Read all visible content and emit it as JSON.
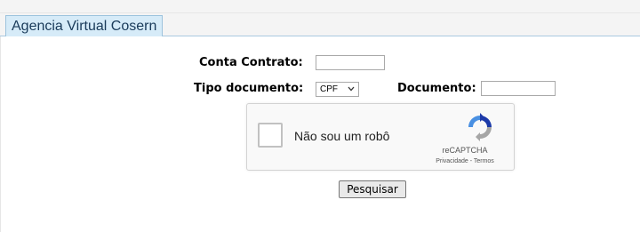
{
  "app": {
    "tab_label": "Agencia Virtual Cosern"
  },
  "form": {
    "conta_contrato_label": "Conta Contrato:",
    "conta_contrato_value": "",
    "tipo_documento_label": "Tipo documento:",
    "tipo_documento_selected": "CPF",
    "documento_label": "Documento:",
    "documento_value": ""
  },
  "captcha": {
    "checkbox_text": "Não sou um robô",
    "brand": "reCAPTCHA",
    "links": "Privacidade - Termos",
    "checked": false
  },
  "actions": {
    "search_label": "Pesquisar"
  },
  "colors": {
    "tab_bg": "#d6ebf8",
    "tab_border": "#9cc3dd",
    "captcha_blue": "#1c3aa9",
    "captcha_lightblue": "#4a90e2",
    "captcha_gray": "#a6a6a6"
  }
}
